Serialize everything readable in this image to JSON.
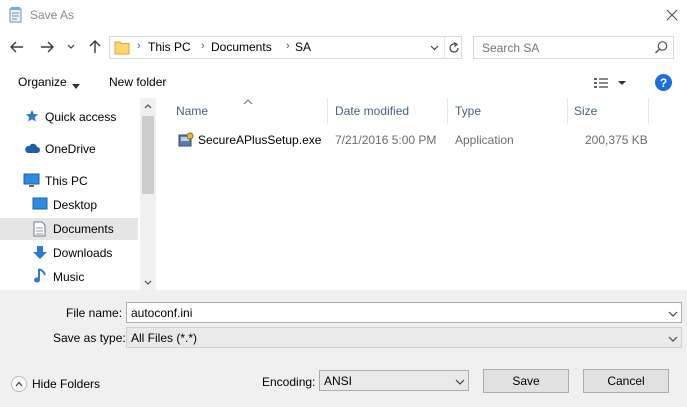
{
  "window": {
    "title": "Save As"
  },
  "address": {
    "crumbs": [
      "This PC",
      "Documents",
      "SA"
    ]
  },
  "search": {
    "placeholder": "Search SA"
  },
  "toolbar": {
    "organize_label": "Organize",
    "new_folder_label": "New folder",
    "help_label": "?"
  },
  "nav": {
    "items": [
      {
        "label": "Quick access",
        "icon": "star-icon"
      },
      {
        "label": "OneDrive",
        "icon": "cloud-icon"
      },
      {
        "label": "This PC",
        "icon": "computer-icon"
      },
      {
        "label": "Desktop",
        "icon": "desktop-icon"
      },
      {
        "label": "Documents",
        "icon": "document-icon",
        "selected": true
      },
      {
        "label": "Downloads",
        "icon": "download-arrow-icon"
      },
      {
        "label": "Music",
        "icon": "music-note-icon"
      }
    ]
  },
  "columns": {
    "name": "Name",
    "date": "Date modified",
    "type": "Type",
    "size": "Size"
  },
  "files": [
    {
      "name": "SecureAPlusSetup.exe",
      "date": "7/21/2016 5:00 PM",
      "type": "Application",
      "size": "200,375 KB",
      "icon": "installer-icon"
    }
  ],
  "form": {
    "filename_label": "File name:",
    "filename_value": "autoconf.ini",
    "savetype_label": "Save as type:",
    "savetype_value": "All Files  (*.*)",
    "encoding_label": "Encoding:",
    "encoding_value": "ANSI"
  },
  "buttons": {
    "hide_folders": "Hide Folders",
    "save": "Save",
    "cancel": "Cancel"
  },
  "colors": {
    "accent": "#1c6fd4",
    "selected_nav": "#e5e5e5",
    "column_header_text": "#4c607a",
    "bottom_panel": "#f0f0f0"
  }
}
